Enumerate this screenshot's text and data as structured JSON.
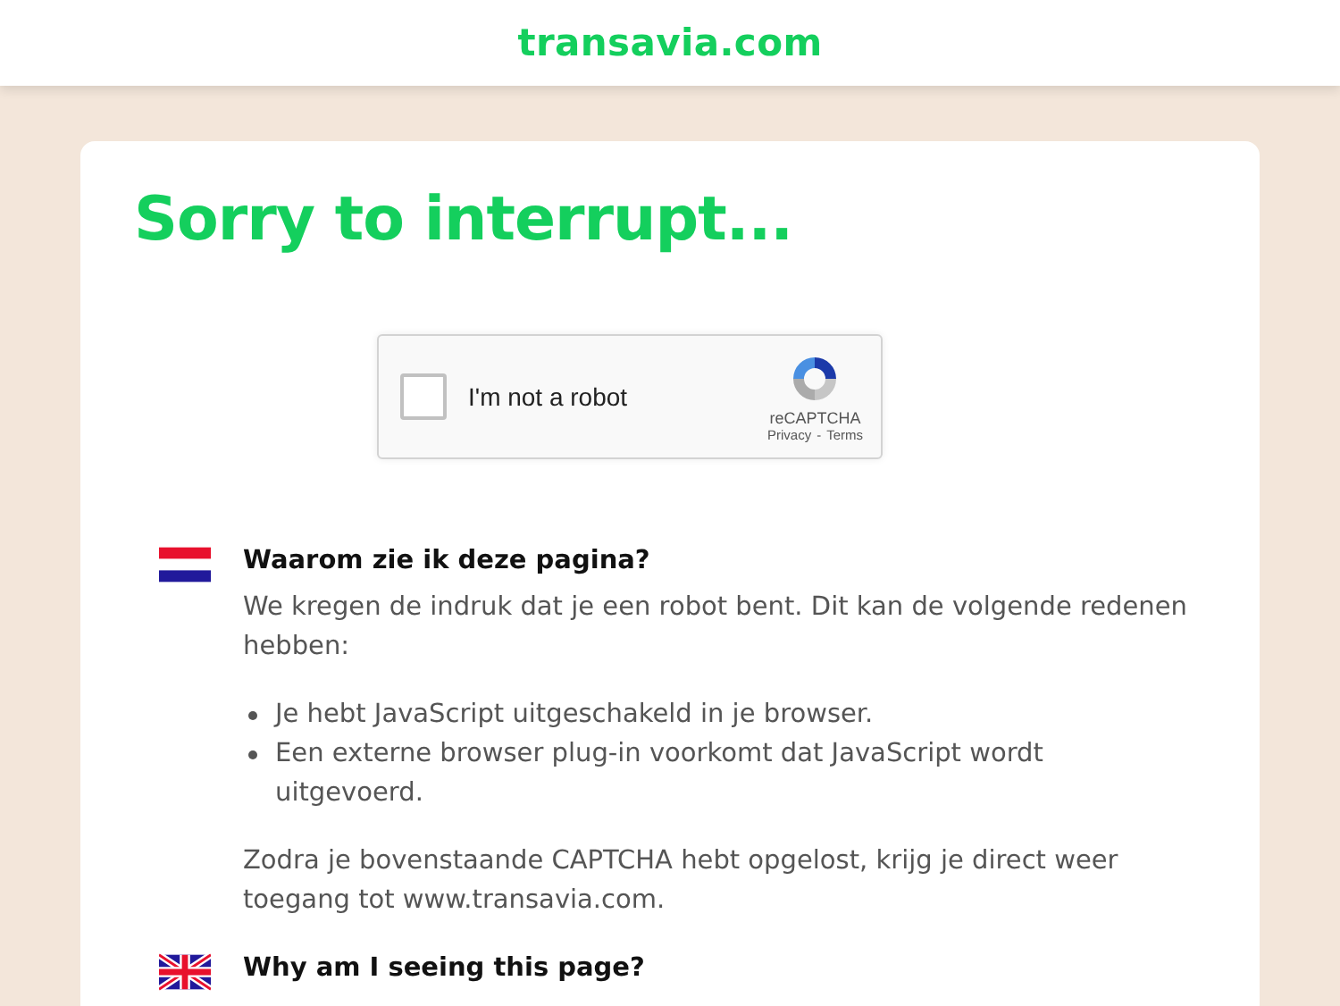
{
  "header": {
    "logo": "transavia.com"
  },
  "title": "Sorry to interrupt...",
  "captcha": {
    "checked": false,
    "label": "I'm not a robot",
    "brand": "reCAPTCHA",
    "links": [
      "Privacy",
      "Terms"
    ],
    "separator": "-"
  },
  "sections": [
    {
      "kind": "nl",
      "heading": "Waarom zie ik deze pagina?",
      "intro": "We kregen de indruk dat je een robot bent. Dit kan de volgende redenen hebben:",
      "bullets": [
        "Je hebt JavaScript uitgeschakeld in je browser.",
        "Een externe browser plug-in voorkomt dat JavaScript wordt uitgevoerd."
      ],
      "outro": "Zodra je bovenstaande CAPTCHA hebt opgelost, krijg je direct weer toegang tot www.transavia.com."
    },
    {
      "kind": "uk",
      "heading": "Why am I seeing this page?"
    }
  ]
}
